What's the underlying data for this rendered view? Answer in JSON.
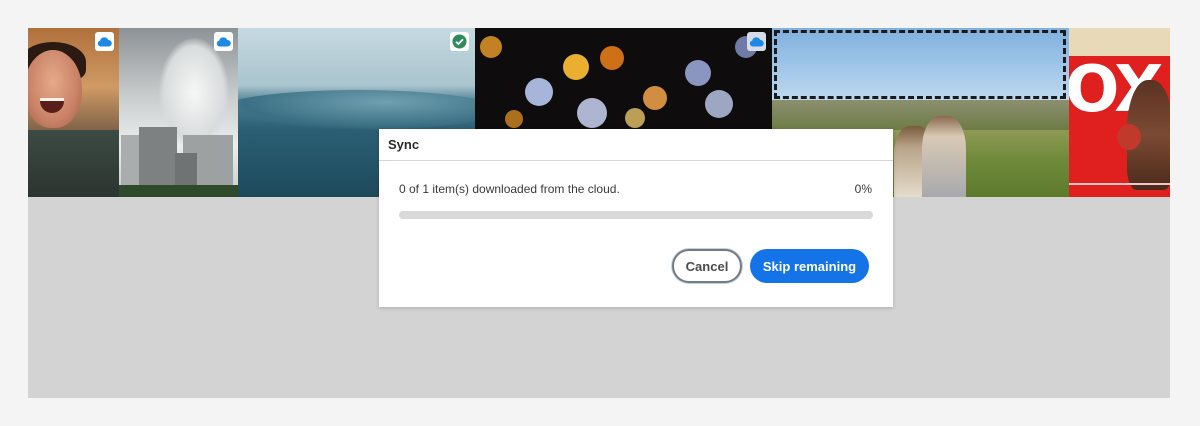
{
  "thumbnails": [
    {
      "name": "swimmer",
      "badge": "cloud-icon"
    },
    {
      "name": "buildings",
      "badge": "cloud-icon"
    },
    {
      "name": "ocean",
      "badge": "check-icon"
    },
    {
      "name": "bokeh",
      "badge": "cloud-icon"
    },
    {
      "name": "field",
      "badge": null,
      "selected": true
    },
    {
      "name": "boxing-poster",
      "badge": null,
      "poster_text": "OX"
    }
  ],
  "colors": {
    "accent": "#1473e6",
    "cloud_badge": "#1e88e5",
    "check_badge": "#2d8c5a"
  },
  "dialog": {
    "title": "Sync",
    "status_text": "0 of 1 item(s) downloaded from the cloud.",
    "percent_label": "0%",
    "progress": 0,
    "cancel_label": "Cancel",
    "skip_label": "Skip remaining"
  }
}
